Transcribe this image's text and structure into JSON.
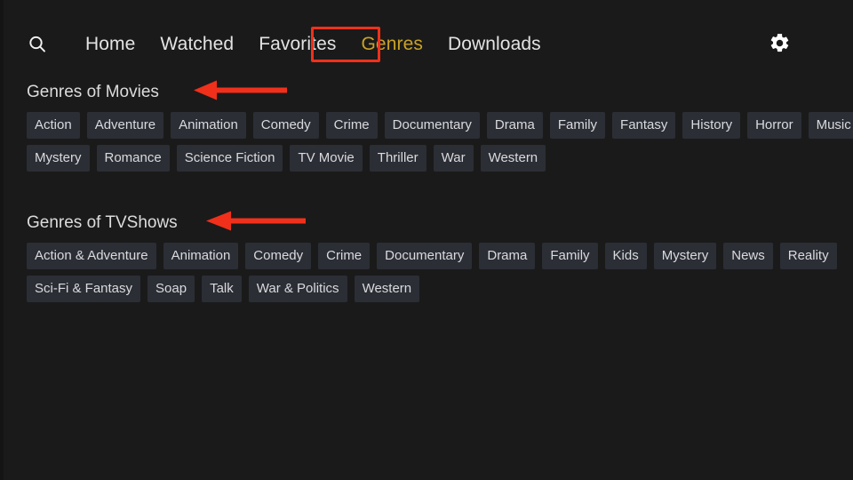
{
  "theme": {
    "background": "#1a1a1a",
    "chip_background": "#2b2e35",
    "chip_text": "#d9dade",
    "nav_text": "#e3e3e3",
    "active_nav_text": "#c9a227",
    "annotation_red": "#f0301a"
  },
  "topbar": {
    "search_icon": "search-icon",
    "settings_icon": "gear-icon",
    "nav_items": [
      {
        "label": "Home",
        "active": false
      },
      {
        "label": "Watched",
        "active": false
      },
      {
        "label": "Favorites",
        "active": false
      },
      {
        "label": "Genres",
        "active": true
      },
      {
        "label": "Downloads",
        "active": false
      }
    ]
  },
  "annotations": {
    "highlight_box_target": "Genres",
    "arrow_movies": "arrow-left-icon",
    "arrow_tvshows": "arrow-left-icon"
  },
  "sections": [
    {
      "title": "Genres of Movies",
      "rows": [
        [
          "Action",
          "Adventure",
          "Animation",
          "Comedy",
          "Crime",
          "Documentary",
          "Drama",
          "Family",
          "Fantasy",
          "History",
          "Horror",
          "Music"
        ],
        [
          "Mystery",
          "Romance",
          "Science Fiction",
          "TV Movie",
          "Thriller",
          "War",
          "Western"
        ]
      ]
    },
    {
      "title": "Genres of TVShows",
      "rows": [
        [
          "Action & Adventure",
          "Animation",
          "Comedy",
          "Crime",
          "Documentary",
          "Drama",
          "Family",
          "Kids",
          "Mystery",
          "News",
          "Reality"
        ],
        [
          "Sci-Fi & Fantasy",
          "Soap",
          "Talk",
          "War & Politics",
          "Western"
        ]
      ]
    }
  ]
}
